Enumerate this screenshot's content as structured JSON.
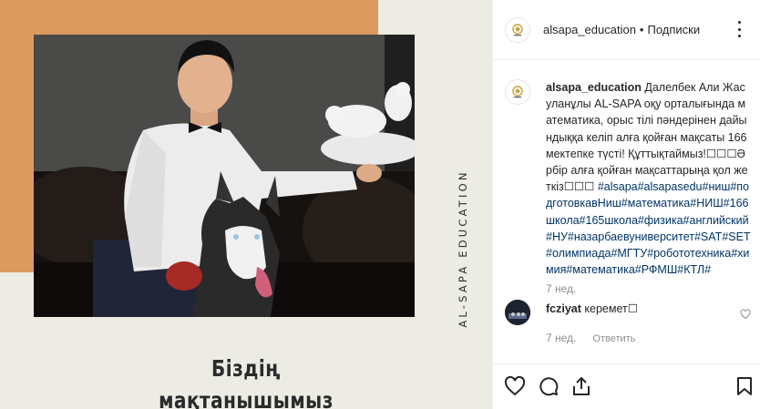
{
  "post": {
    "vertical_text": "AL-SAPA EDUCATION",
    "caption_line1": "Біздің",
    "caption_line2": "мақтанышымыз"
  },
  "header": {
    "username": "alsapa_education",
    "separator": "•",
    "follow_label": "Подписки",
    "avatar_icon": "alsapa-logo-icon",
    "more_icon": "more-vertical-icon"
  },
  "caption": {
    "username": "alsapa_education",
    "text": "Далелбек Али Жасуланұлы AL-SAPA оқу орталығында математика, орыс тілі пәндерінен дайындыққа келіп алға қойған мақсаты 166 мектепке түсті! Құттықтаймыз!☐☐☐Әрбір алға қойған мақсаттарыңа қол жеткіз☐☐☐",
    "hashtags": "#alsapa#alsapasedu#ниш#подготовкавНиш#математика#НИШ#166школа#165школа#физика#английский#НУ#назарбаеву­ниверситет#SAT#SET#олимпиада#МГТУ#робототехника#химия#математика#РФМШ#КТЛ#",
    "time": "7 нед."
  },
  "comment": {
    "username": "fcziyat",
    "text": "керемет☐",
    "time": "7 нед.",
    "reply_label": "Ответить",
    "like_icon": "heart-outline-icon"
  },
  "actions": {
    "like_icon": "heart-outline-icon",
    "comment_icon": "comment-bubble-icon",
    "share_icon": "share-icon",
    "save_icon": "bookmark-icon"
  },
  "colors": {
    "orange_block": "#dd9a5e",
    "post_background": "#ecebe4",
    "hashtag_link": "#003569",
    "muted_text": "#8e8e8e"
  }
}
